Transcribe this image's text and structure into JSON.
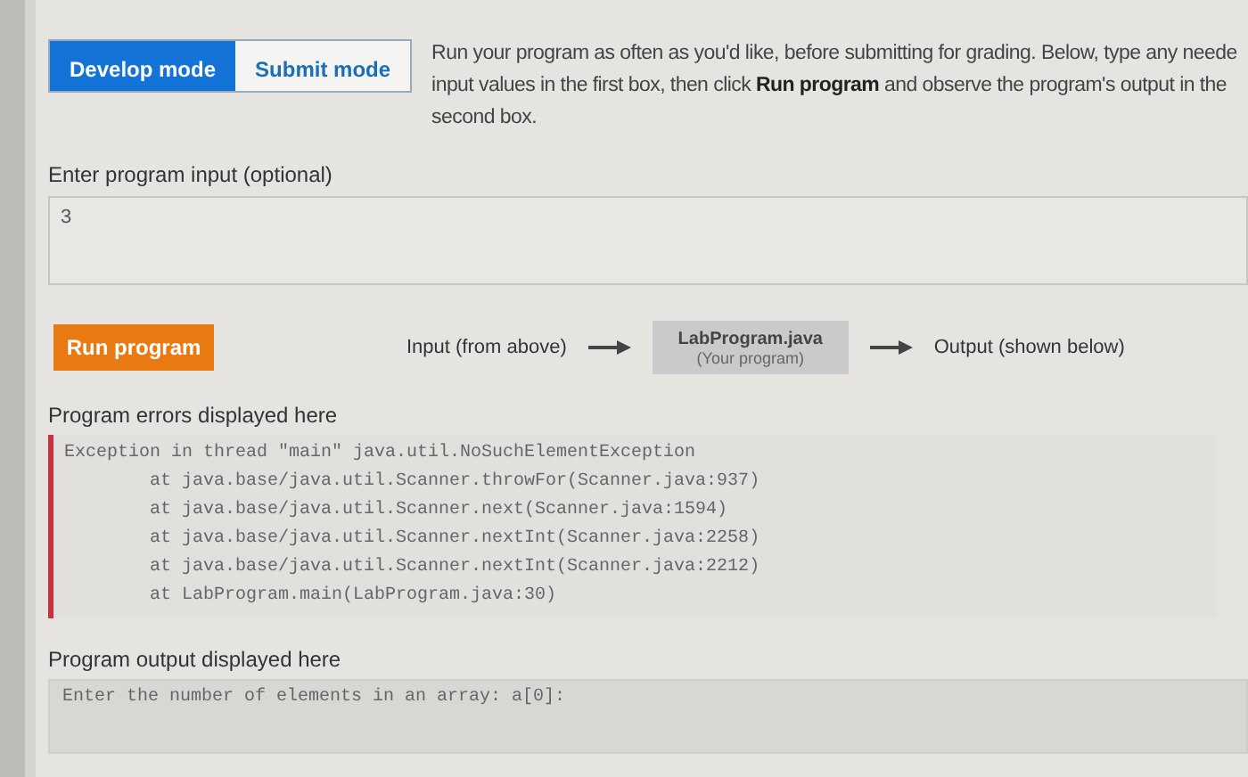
{
  "modes": [
    {
      "label": "Develop mode",
      "selected": true
    },
    {
      "label": "Submit mode",
      "selected": false
    }
  ],
  "instructions": "Run your program as often as you'd like, before submitting for grading. Below, type any neede input values in the first box, then click **Run program** and observe the program's output in the second box.",
  "input": {
    "label": "Enter program input (optional)",
    "value": "3"
  },
  "run_button": "Run program",
  "flow": {
    "input_label": "Input (from above)",
    "program_name": "LabProgram.java",
    "program_note": "(Your program)",
    "output_label": "Output (shown below)"
  },
  "errors": {
    "label": "Program errors displayed here",
    "lines": [
      "Exception in thread \"main\" java.util.NoSuchElementException",
      "        at java.base/java.util.Scanner.throwFor(Scanner.java:937)",
      "        at java.base/java.util.Scanner.next(Scanner.java:1594)",
      "        at java.base/java.util.Scanner.nextInt(Scanner.java:2258)",
      "        at java.base/java.util.Scanner.nextInt(Scanner.java:2212)",
      "        at LabProgram.main(LabProgram.java:30)"
    ]
  },
  "output": {
    "label": "Program output displayed here",
    "text": "Enter the number of elements in an array: a[0]:"
  }
}
